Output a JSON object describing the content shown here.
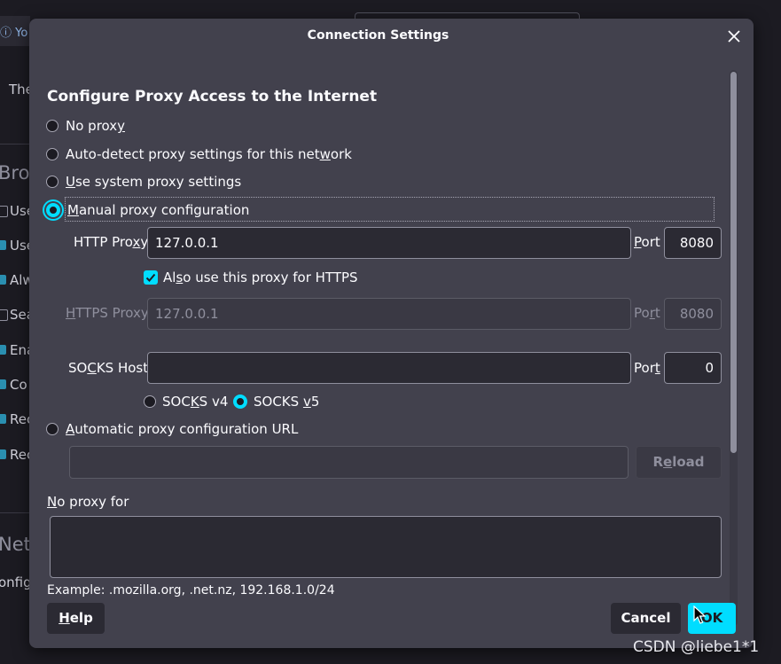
{
  "background": {
    "topbar_text": "Yo",
    "partial_texts": [
      "The",
      "Brov",
      "Use",
      "Use",
      "Alw",
      "Sea",
      "Ena",
      "Co",
      "Rec",
      "Rec",
      "Netv",
      "onfig"
    ]
  },
  "dialog": {
    "title": "Connection Settings",
    "heading": "Configure Proxy Access to the Internet",
    "radios": {
      "no_proxy": {
        "pre": "No prox",
        "key": "y",
        "post": "",
        "selected": false
      },
      "auto_detect": {
        "pre": "Auto-detect proxy settings for this net",
        "key": "w",
        "post": "ork",
        "selected": false
      },
      "system": {
        "pre": "",
        "key": "U",
        "post": "se system proxy settings",
        "selected": false
      },
      "manual": {
        "pre": "",
        "key": "M",
        "post": "anual proxy configuration",
        "selected": true
      },
      "auto_url": {
        "pre": "",
        "key": "A",
        "post": "utomatic proxy configuration URL",
        "selected": false
      }
    },
    "http": {
      "label_pre": "HTTP Pro",
      "label_key": "x",
      "label_post": "y",
      "value": "127.0.0.1",
      "port_label_key": "P",
      "port_label_post": "ort",
      "port": "8080"
    },
    "also_https": {
      "pre": "Al",
      "key": "s",
      "post": "o use this proxy for HTTPS",
      "checked": true
    },
    "https": {
      "label_key": "H",
      "label_post": "TTPS Proxy",
      "value": "127.0.0.1",
      "port_label_pre": "Po",
      "port_label_key": "r",
      "port_label_post": "t",
      "port": "8080"
    },
    "socks": {
      "label_pre": "SO",
      "label_key": "C",
      "label_post": "KS Host",
      "value": "",
      "port_label_pre": "Por",
      "port_label_key": "t",
      "port_label_post": "",
      "port": "0"
    },
    "socks_v4": {
      "pre": "SOC",
      "key": "K",
      "post": "S v4",
      "selected": false
    },
    "socks_v5": {
      "pre": "SOCKS ",
      "key": "v",
      "post": "5",
      "selected": true
    },
    "auto_url_value": "",
    "reload_pre": "R",
    "reload_key": "e",
    "reload_post": "load",
    "no_proxy_for_key": "N",
    "no_proxy_for_post": "o proxy for",
    "no_proxy_for_value": "",
    "example": "Example: .mozilla.org, .net.nz, 192.168.1.0/24",
    "help_key": "H",
    "help_post": "elp",
    "cancel": "Cancel",
    "ok": "OK"
  },
  "watermark": "CSDN @liebe1*1",
  "colors": {
    "accent": "#00ddff",
    "dialog_bg": "#42414d",
    "field_bg": "#2b2a33",
    "page_bg": "#1c1b22"
  }
}
